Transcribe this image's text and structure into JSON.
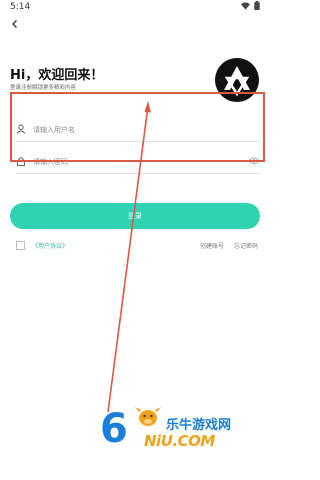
{
  "status_bar": {
    "time": "5:14"
  },
  "header": {
    "greeting": "Hi，欢迎回来！",
    "subtitle": "登录注册解锁更多精彩内容"
  },
  "form": {
    "username_placeholder": "请输入用户名",
    "password_placeholder": "请输入密码"
  },
  "login_button": {
    "label": "登录"
  },
  "agreement": {
    "label": "《用户协议》"
  },
  "footer_links": {
    "register": "创建账号",
    "forgot": "忘记密码"
  },
  "watermark": {
    "digit": "6",
    "cn": "乐牛游戏网",
    "en": "NiU.COM"
  },
  "colors": {
    "accent": "#2fd3b2",
    "annotation": "#d95a45",
    "watermark_blue": "#1a7fd8",
    "watermark_orange": "#f2a21a"
  },
  "icons": [
    "back-arrow-icon",
    "wifi-icon",
    "battery-icon",
    "user-icon",
    "lock-icon",
    "eye-icon",
    "app-logo-icon"
  ]
}
